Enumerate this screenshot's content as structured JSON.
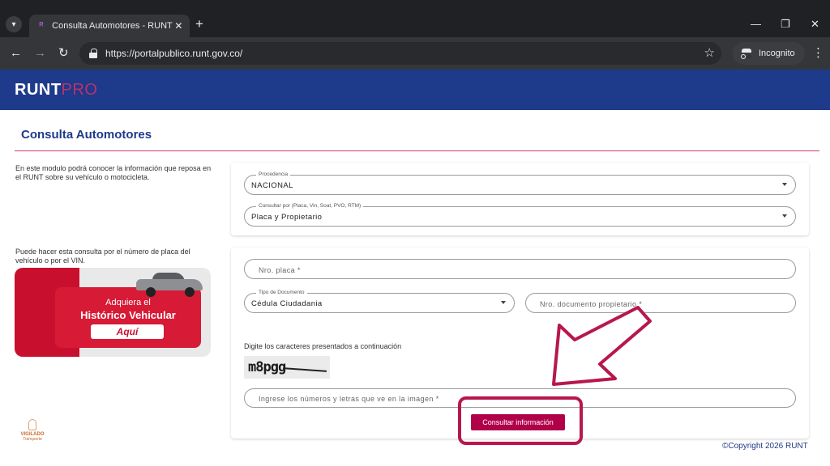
{
  "browser": {
    "tab_title": "Consulta Automotores - RUNT",
    "tab_close": "✕",
    "new_tab": "+",
    "url": "https://portalpublico.runt.gov.co/",
    "incognito_label": "Incognito",
    "window_minimize": "—",
    "window_restore": "❐",
    "window_close": "✕"
  },
  "header": {
    "logo_primary": "RUNT",
    "logo_secondary": "PRO"
  },
  "page": {
    "title": "Consulta Automotores",
    "intro_text": "En este modulo podrá conocer la información que reposa en el RUNT sobre su vehículo o motocicleta.",
    "plate_info_text": "Puede hacer esta consulta por el número de placa del vehículo o por el VIN.",
    "copyright": "©Copyright 2026 RUNT"
  },
  "banner": {
    "line1": "Adquiera el",
    "line2": "Histórico Vehicular",
    "button": "Aquí"
  },
  "vigilado": {
    "line1": "VIGILADO",
    "line2": "Transporte"
  },
  "form": {
    "procedencia": {
      "label": "Procedencia",
      "value": "NACIONAL"
    },
    "consultar_por": {
      "label": "Consultar por (Placa, Vin, Soat, PVO, RTM)",
      "value": "Placa y Propietario"
    },
    "placa": {
      "placeholder": "Nro. placa *"
    },
    "tipo_documento": {
      "label": "Tipo de Documento",
      "value": "Cédula Ciudadania"
    },
    "nro_documento": {
      "placeholder": "Nro. documento propietario  *"
    },
    "captcha_label": "Digite los caracteres presentados a continuación",
    "captcha_text": "m8pgg",
    "captcha_input": {
      "placeholder": "Ingrese los números y letras que ve en la imagen *"
    },
    "submit_label": "Consultar información"
  },
  "colors": {
    "header_blue": "#1e3a8a",
    "accent_magenta": "#b0004a",
    "annotation_red": "#b7174f"
  }
}
